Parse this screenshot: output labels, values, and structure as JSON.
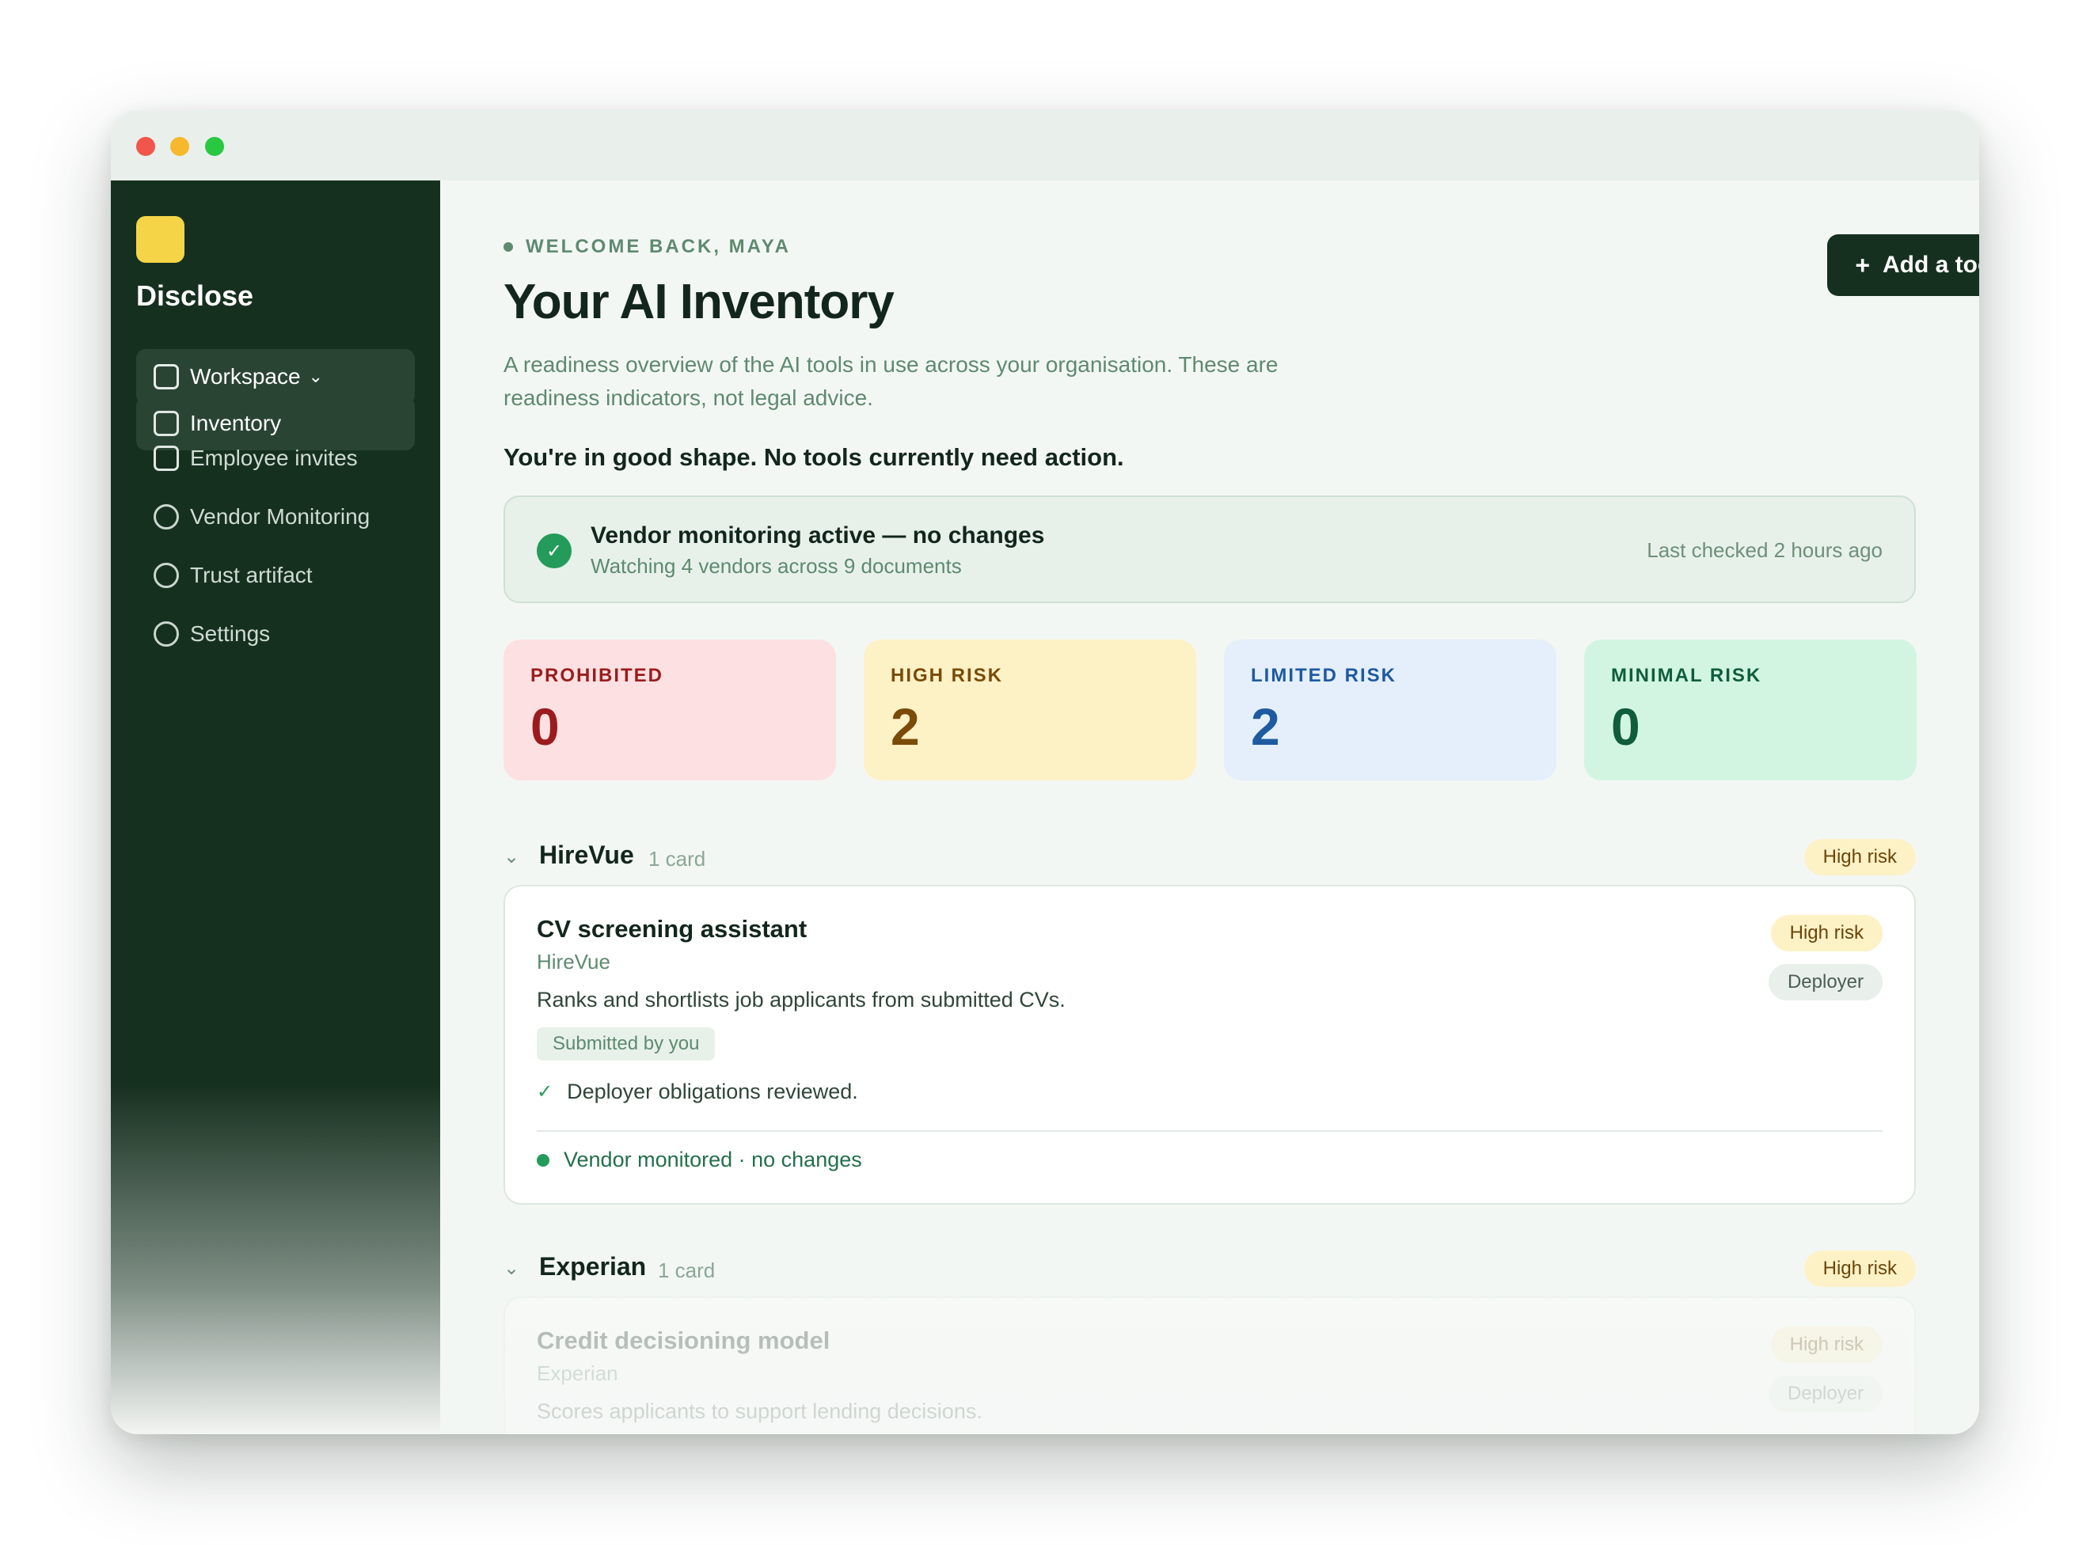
{
  "app": {
    "brand": "Disclose"
  },
  "sidebar": {
    "workspace_label": "Workspace",
    "items": [
      {
        "label": "Inventory",
        "icon": "square-icon",
        "active": true
      },
      {
        "label": "Employee invites",
        "icon": "square-icon",
        "active": false
      },
      {
        "label": "Vendor Monitoring",
        "icon": "circle-icon",
        "active": false
      },
      {
        "label": "Trust artifact",
        "icon": "circle-icon",
        "active": false
      },
      {
        "label": "Settings",
        "icon": "circle-icon",
        "active": false
      }
    ]
  },
  "header": {
    "welcome": "WELCOME BACK, MAYA",
    "title": "Your AI Inventory",
    "subtitle": "A readiness overview of the AI tools in use across your organisation. These are readiness indicators, not legal advice.",
    "add_button": "Add a tool"
  },
  "status_line": "You're in good shape. No tools currently need action.",
  "vendor_monitoring": {
    "title": "Vendor monitoring active — no changes",
    "subtitle": "Watching 4 vendors across 9 documents",
    "last_checked": "Last checked 2 hours ago"
  },
  "stats": [
    {
      "label": "PROHIBITED",
      "value": "0",
      "color": "#9b1c1c"
    },
    {
      "label": "HIGH RISK",
      "value": "2",
      "color": "#7a4a08"
    },
    {
      "label": "LIMITED RISK",
      "value": "2",
      "color": "#1e5aa0"
    },
    {
      "label": "MINIMAL RISK",
      "value": "0",
      "color": "#0f5d3a"
    }
  ],
  "groups": [
    {
      "vendor": "HireVue",
      "count": "1 card",
      "risk": "High risk",
      "card": {
        "name": "CV screening assistant",
        "vendor": "HireVue",
        "description": "Ranks and shortlists job applicants from submitted CVs.",
        "submitted": "Submitted by you",
        "obligation": "Deployer obligations reviewed.",
        "monitor": "Vendor monitored · no changes",
        "risk_badge": "High risk",
        "role_badge": "Deployer"
      }
    },
    {
      "vendor": "Experian",
      "count": "1 card",
      "risk": "High risk",
      "card": {
        "name": "Credit decisioning model",
        "vendor": "Experian",
        "description": "Scores applicants to support lending decisions.",
        "risk_badge": "High risk",
        "role_badge": "Deployer"
      }
    }
  ]
}
